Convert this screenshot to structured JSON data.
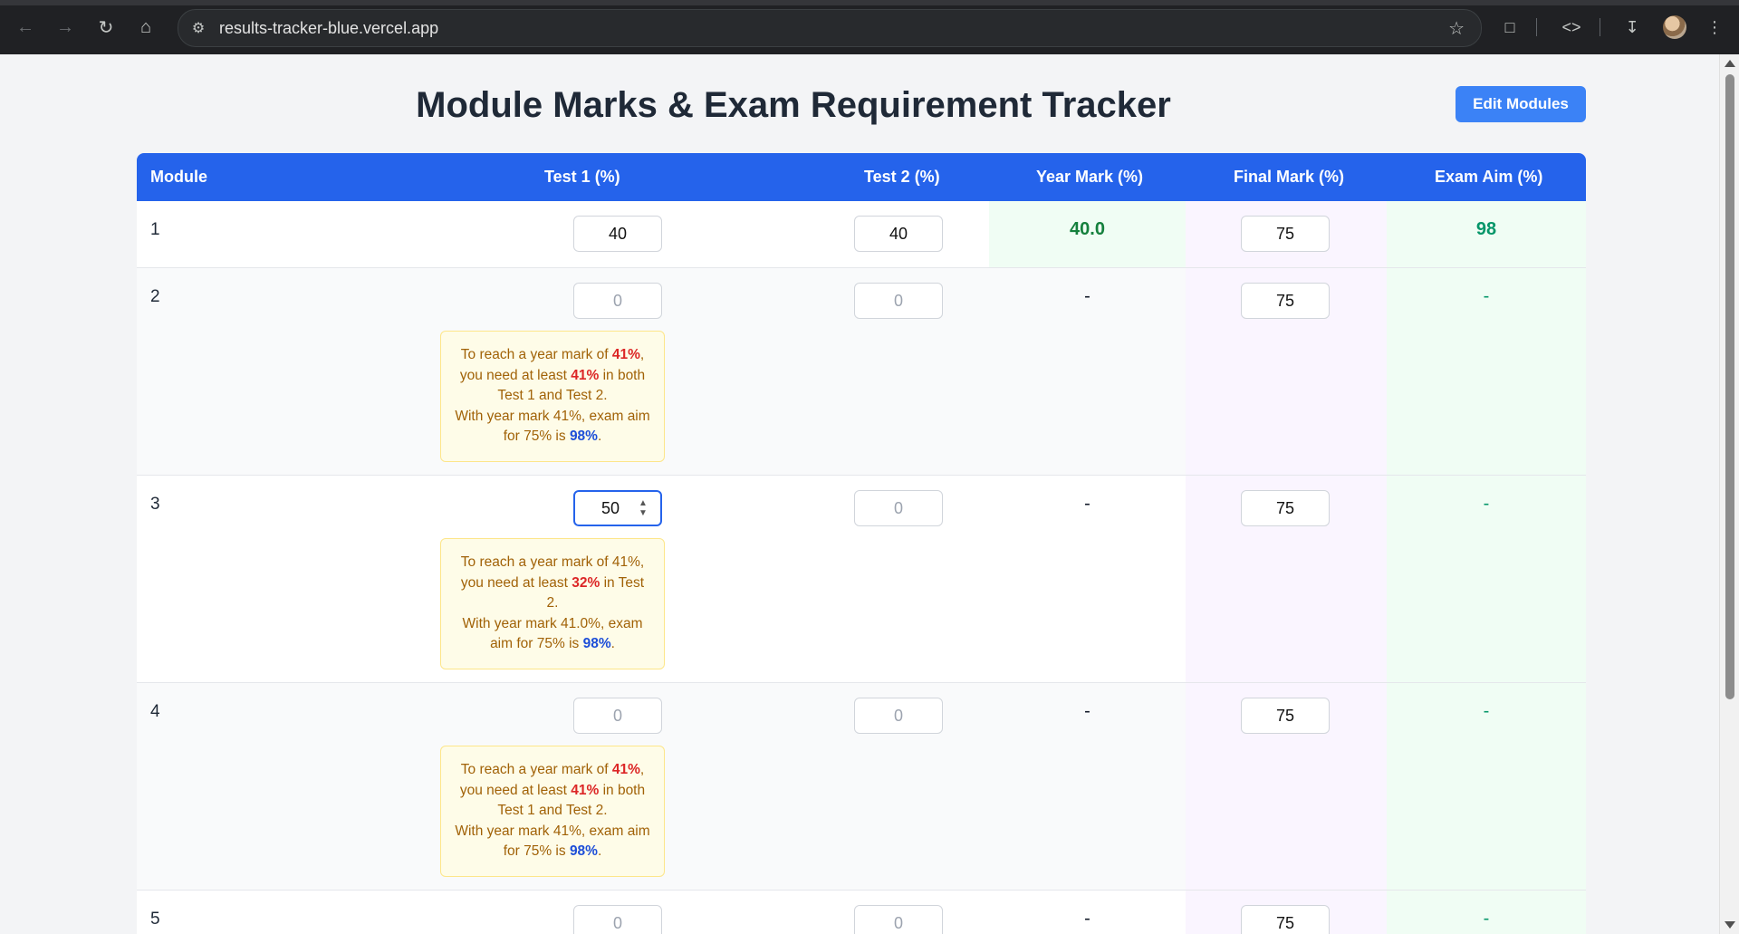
{
  "browser": {
    "url": "results-tracker-blue.vercel.app"
  },
  "page": {
    "title": "Module Marks & Exam Requirement Tracker",
    "edit_button": "Edit Modules"
  },
  "table": {
    "headers": [
      "Module",
      "Test 1 (%)",
      "Test 2 (%)",
      "Year Mark (%)",
      "Final Mark (%)",
      "Exam Aim (%)"
    ],
    "rows": [
      {
        "module": "1",
        "test1": "40",
        "test1_placeholder": "",
        "test2": "40",
        "test2_placeholder": "",
        "year_mark": "40.0",
        "final_mark": "75",
        "exam_aim": "98"
      },
      {
        "module": "2",
        "test1": "",
        "test1_placeholder": "0",
        "test2": "",
        "test2_placeholder": "0",
        "year_mark": "-",
        "final_mark": "75",
        "exam_aim": "-",
        "note": {
          "l1a": "To reach a year mark of ",
          "l1b": "41%",
          "l1c": ",",
          "l2a": "you need at least ",
          "l2b": "41%",
          "l2c": " in both",
          "l3": "Test 1 and Test 2.",
          "l4": "With year mark 41%, exam aim",
          "l5a": "for 75% is ",
          "l5b": "98%",
          "l5c": "."
        }
      },
      {
        "module": "3",
        "test1": "50",
        "test1_placeholder": "",
        "test2": "",
        "test2_placeholder": "0",
        "year_mark": "-",
        "final_mark": "75",
        "exam_aim": "-",
        "note": {
          "l1": "To reach a year mark of 41%,",
          "l2a": "you need at least ",
          "l2b": "32%",
          "l2c": " in Test",
          "l3": "2.",
          "l4": "With year mark 41.0%, exam",
          "l5a": "aim for 75% is ",
          "l5b": "98%",
          "l5c": "."
        }
      },
      {
        "module": "4",
        "test1": "",
        "test1_placeholder": "0",
        "test2": "",
        "test2_placeholder": "0",
        "year_mark": "-",
        "final_mark": "75",
        "exam_aim": "-",
        "note": {
          "l1a": "To reach a year mark of ",
          "l1b": "41%",
          "l1c": ",",
          "l2a": "you need at least ",
          "l2b": "41%",
          "l2c": " in both",
          "l3": "Test 1 and Test 2.",
          "l4": "With year mark 41%, exam aim",
          "l5a": "for 75% is ",
          "l5b": "98%",
          "l5c": "."
        }
      },
      {
        "module": "5",
        "test1": "",
        "test1_placeholder": "0",
        "test2": "",
        "test2_placeholder": "0",
        "year_mark": "-",
        "final_mark": "75",
        "exam_aim": "-"
      }
    ]
  }
}
